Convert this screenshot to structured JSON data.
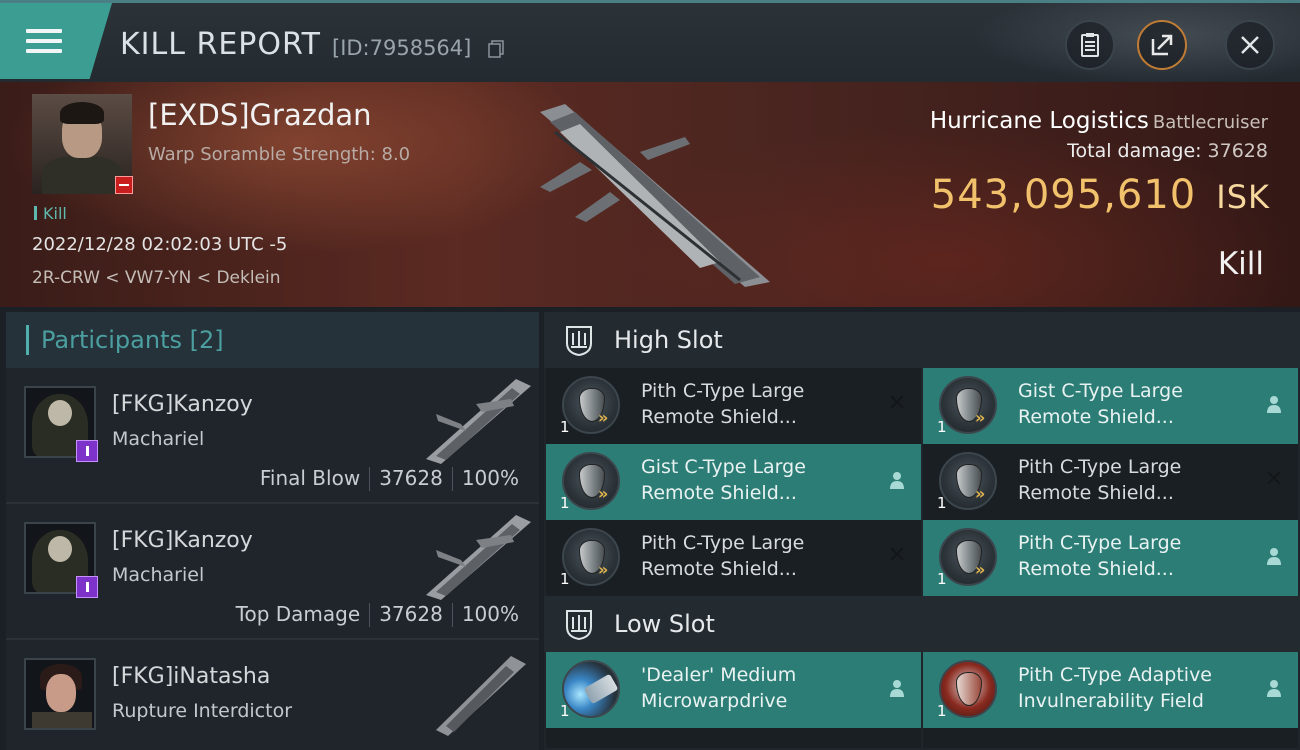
{
  "header": {
    "title": "KILL REPORT",
    "id_label": "[ID:7958564]"
  },
  "victim": {
    "name": "[EXDS]Grazdan",
    "scramble": "Warp Soramble Strength: 8.0",
    "kill_tag": "Kill",
    "date": "2022/12/28 02:02:03 UTC -5",
    "location": "2R-CRW < VW7-YN < Deklein",
    "ship_name": "Hurricane Logistics",
    "ship_class": "Battlecruiser",
    "total_damage_label": "Total damage:",
    "total_damage": "37628",
    "isk_value": "543,095,610",
    "isk_unit": "ISK",
    "result": "Kill"
  },
  "participants": {
    "title": "Participants [2]",
    "rows": [
      {
        "name": "[FKG]Kanzoy",
        "ship": "Machariel",
        "role": "Final Blow",
        "damage": "37628",
        "pct": "100%"
      },
      {
        "name": "[FKG]Kanzoy",
        "ship": "Machariel",
        "role": "Top Damage",
        "damage": "37628",
        "pct": "100%"
      },
      {
        "name": "[FKG]iNatasha",
        "ship": "Rupture Interdictor"
      }
    ]
  },
  "fitting": {
    "high_slot_label": "High Slot",
    "low_slot_label": "Low Slot",
    "high": [
      {
        "line1": "Pith C-Type Large",
        "line2": "Remote Shield...",
        "qty": "1",
        "status": "destroyed"
      },
      {
        "line1": "Gist C-Type Large",
        "line2": "Remote Shield...",
        "qty": "1",
        "status": "dropped"
      },
      {
        "line1": "Gist C-Type Large",
        "line2": "Remote Shield...",
        "qty": "1",
        "status": "dropped"
      },
      {
        "line1": "Pith C-Type Large",
        "line2": "Remote Shield...",
        "qty": "1",
        "status": "destroyed"
      },
      {
        "line1": "Pith C-Type Large",
        "line2": "Remote Shield...",
        "qty": "1",
        "status": "destroyed"
      },
      {
        "line1": "Pith C-Type Large",
        "line2": "Remote Shield...",
        "qty": "1",
        "status": "dropped"
      }
    ],
    "low": [
      {
        "line1": "'Dealer' Medium",
        "line2": "Microwarpdrive",
        "qty": "1",
        "status": "dropped"
      },
      {
        "line1": "Pith C-Type Adaptive",
        "line2": "Invulnerability Field",
        "qty": "1",
        "status": "dropped"
      }
    ]
  },
  "colors": {
    "accent": "#3c9e93",
    "isk": "#f1c16b",
    "dropped_row": "#2d7d77",
    "destroyed_row": "#1a1f24"
  }
}
